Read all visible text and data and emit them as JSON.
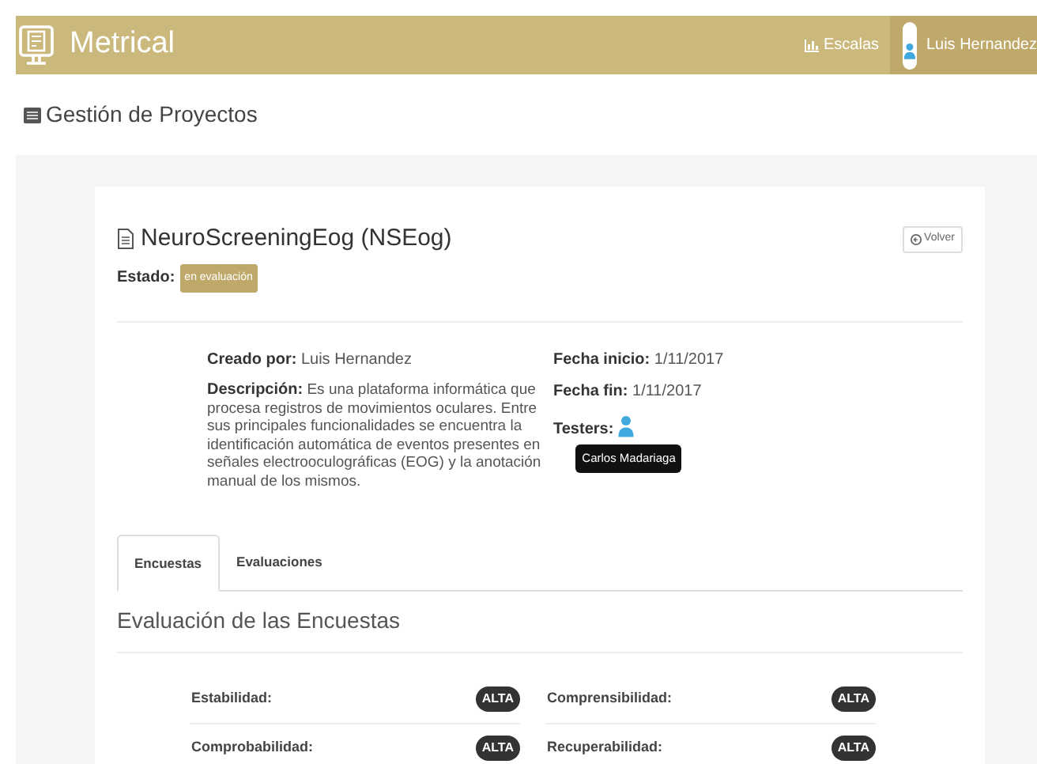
{
  "navbar": {
    "brand": "Metrical",
    "links": [
      {
        "label": "Escalas"
      }
    ],
    "user": "Luis Hernandez"
  },
  "page_title": "Gestión de Proyectos",
  "project": {
    "title": "NeuroScreeningEog (NSEog)",
    "back_button": "Volver",
    "status_label": "Estado:",
    "status": "en evaluación",
    "created_by_label": "Creado por:",
    "created_by": "Luis Hernandez",
    "description_label": "Descripción:",
    "description": "Es una plataforma informática que procesa registros de movimientos oculares. Entre sus principales funcionalidades se encuentra la identificación automática de eventos presentes en señales electrooculográficas (EOG) y la anotación manual de los mismos.",
    "start_label": "Fecha inicio:",
    "start": "1/11/2017",
    "end_label": "Fecha fin:",
    "end": "1/11/2017",
    "testers_label": "Testers:",
    "testers": [
      {
        "tooltip": "Carlos Madariaga"
      }
    ]
  },
  "tabs": [
    {
      "label": "Encuestas",
      "selected": true
    },
    {
      "label": "Evaluaciones",
      "selected": false
    }
  ],
  "section_title": "Evaluación de las Encuestas",
  "ratings": [
    {
      "label": "Estabilidad:",
      "value": "ALTA"
    },
    {
      "label": "Comprensibilidad:",
      "value": "ALTA"
    },
    {
      "label": "Comprobabilidad:",
      "value": "ALTA"
    },
    {
      "label": "Recuperabilidad:",
      "value": "ALTA"
    }
  ]
}
